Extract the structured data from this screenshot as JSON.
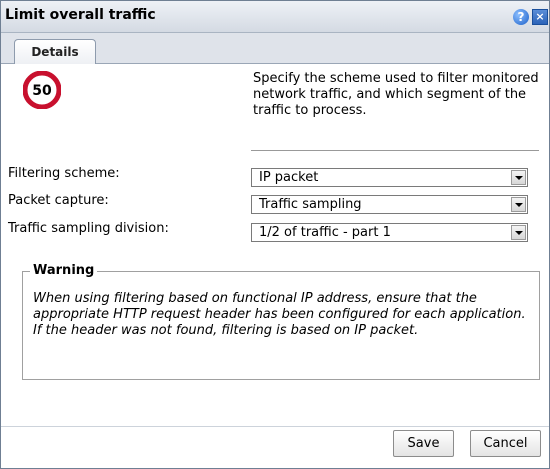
{
  "window": {
    "title": "Limit overall traffic",
    "help_icon": "help-icon",
    "close_icon": "close-icon"
  },
  "tabs": [
    {
      "label": "Details",
      "active": true
    }
  ],
  "header": {
    "icon": "speed-limit-sign-icon",
    "icon_text": "50",
    "description": "Specify the scheme used to filter monitored network traffic, and which segment of the traffic to process."
  },
  "fields": [
    {
      "label": "Filtering scheme:",
      "value": "IP packet"
    },
    {
      "label": "Packet capture:",
      "value": "Traffic sampling"
    },
    {
      "label": "Traffic sampling division:",
      "value": "1/2 of traffic - part 1"
    }
  ],
  "warning": {
    "title": "Warning",
    "text": "When using filtering based on functional IP address, ensure that the appropriate HTTP request header has been configured for each application. If the header was not found, filtering is based on IP packet."
  },
  "buttons": {
    "save": "Save",
    "cancel": "Cancel"
  },
  "colors": {
    "sign_ring": "#c8102e",
    "titlebar": "#d4dae3",
    "close_button": "#2c63b8"
  }
}
